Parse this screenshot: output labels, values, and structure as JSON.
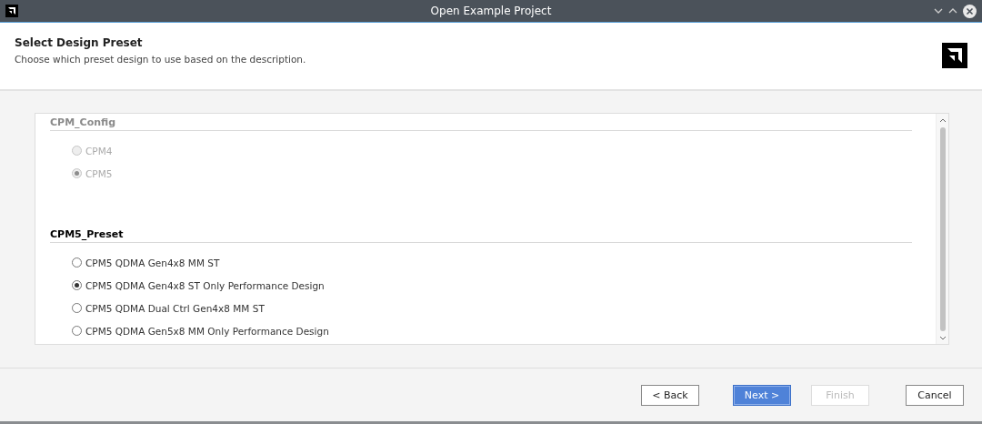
{
  "window": {
    "title": "Open Example Project"
  },
  "header": {
    "title": "Select Design Preset",
    "description": "Choose which preset design to use based on the description."
  },
  "groups": [
    {
      "title": "CPM_Config",
      "disabled": true,
      "options": [
        {
          "label": "CPM4",
          "selected": false
        },
        {
          "label": "CPM5",
          "selected": true
        }
      ]
    },
    {
      "title": "CPM5_Preset",
      "disabled": false,
      "options": [
        {
          "label": "CPM5 QDMA Gen4x8 MM ST",
          "selected": false
        },
        {
          "label": "CPM5 QDMA Gen4x8 ST Only Performance Design",
          "selected": true
        },
        {
          "label": "CPM5 QDMA Dual Ctrl Gen4x8 MM ST",
          "selected": false
        },
        {
          "label": "CPM5 QDMA Gen5x8 MM Only Performance Design",
          "selected": false
        }
      ]
    }
  ],
  "buttons": [
    {
      "label": "< Back",
      "kind": "normal",
      "disabled": false
    },
    {
      "label": "Next >",
      "kind": "default",
      "disabled": false
    },
    {
      "label": "Finish",
      "kind": "normal",
      "disabled": true
    },
    {
      "label": "Cancel",
      "kind": "normal",
      "disabled": false
    }
  ]
}
